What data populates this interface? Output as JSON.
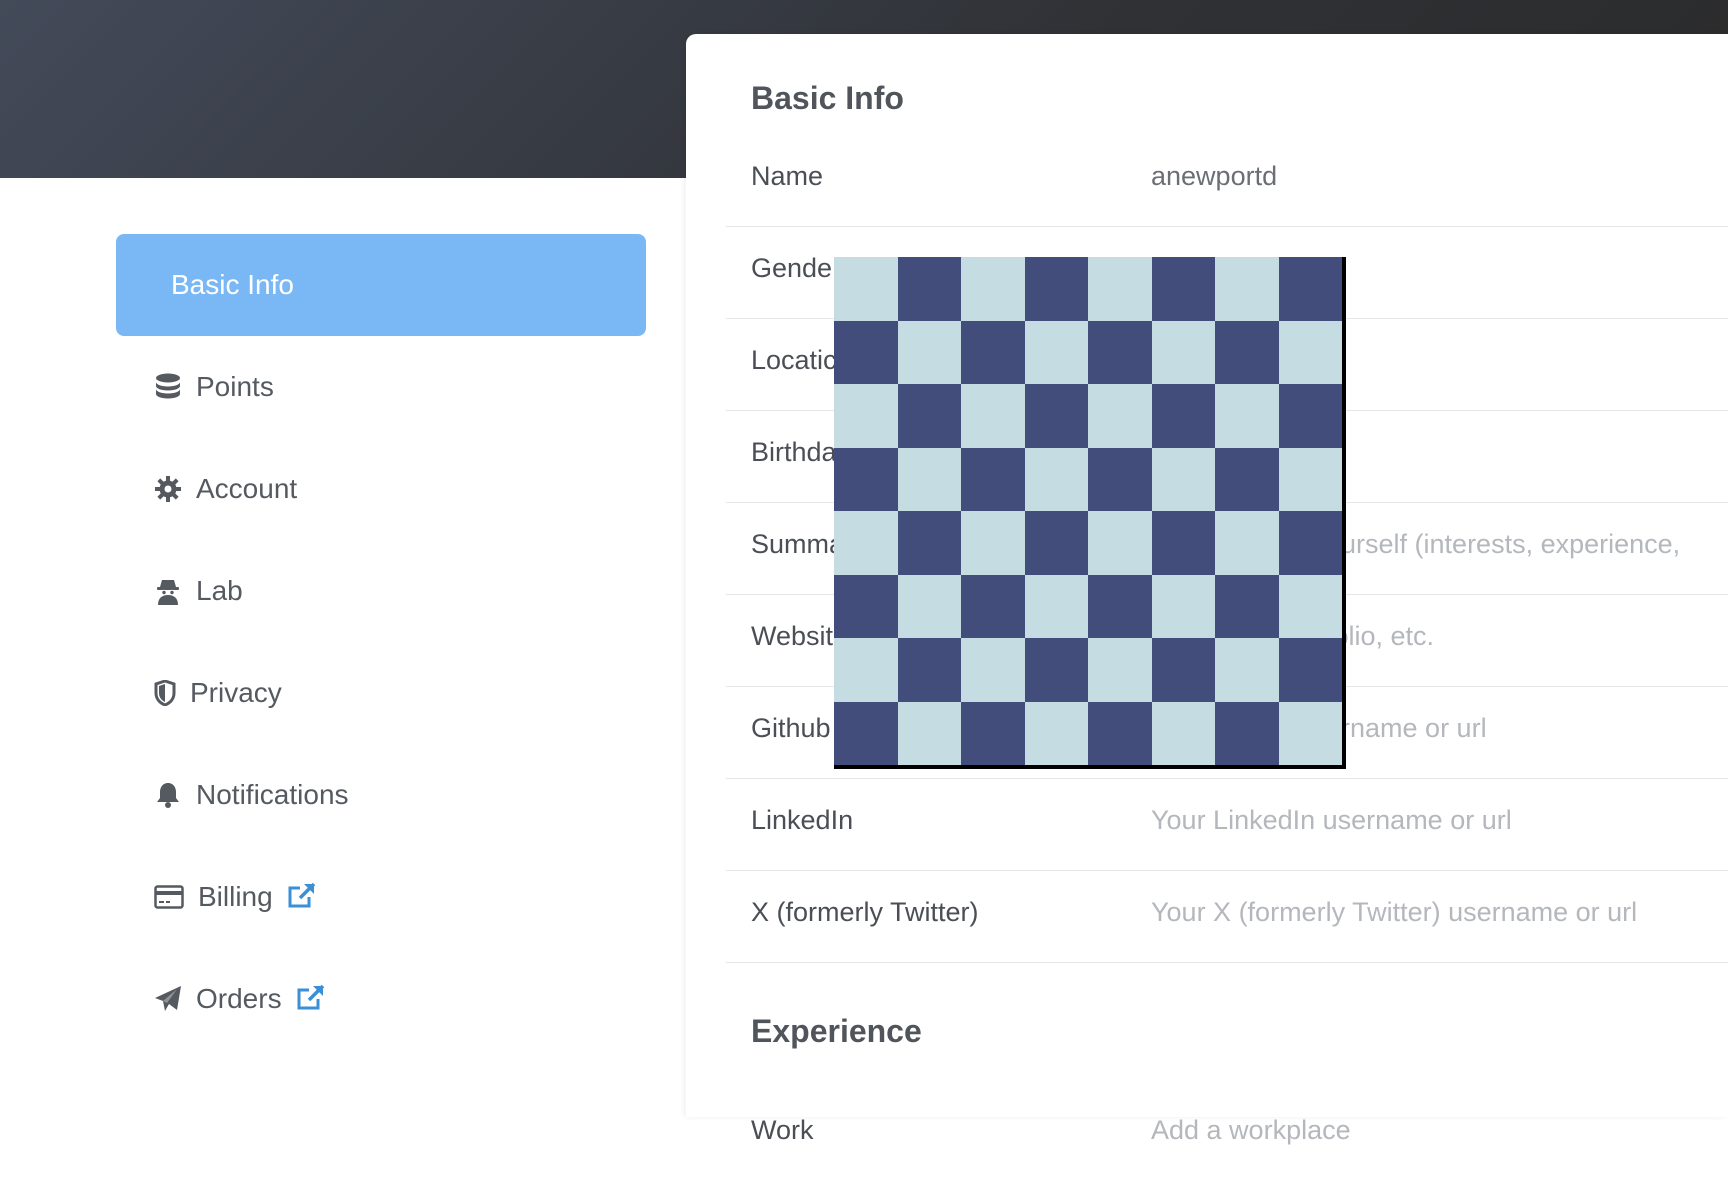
{
  "sidebar": {
    "items": [
      {
        "label": "Basic Info",
        "icon": "none",
        "active": true
      },
      {
        "label": "Points",
        "icon": "database-icon"
      },
      {
        "label": "Account",
        "icon": "gear-icon"
      },
      {
        "label": "Lab",
        "icon": "spy-icon"
      },
      {
        "label": "Privacy",
        "icon": "shield-icon"
      },
      {
        "label": "Notifications",
        "icon": "bell-icon"
      },
      {
        "label": "Billing",
        "icon": "credit-card-icon",
        "external": true
      },
      {
        "label": "Orders",
        "icon": "paper-plane-icon",
        "external": true
      }
    ],
    "active_color": "#7ab8f5",
    "external_link_color": "#3a8fd6"
  },
  "main": {
    "basic_info_title": "Basic Info",
    "fields": [
      {
        "label": "Name",
        "value": "anewportd",
        "placeholder": false
      },
      {
        "label": "Gende",
        "value": "",
        "placeholder": false
      },
      {
        "label": "Locatic",
        "value": "",
        "placeholder": false
      },
      {
        "label": "Birthda",
        "value": "",
        "placeholder": false
      },
      {
        "label": "Summa",
        "value": "ourself (interests, experience,",
        "placeholder": true
      },
      {
        "label": "Websit",
        "value": "folio, etc.",
        "placeholder": true
      },
      {
        "label": "Github",
        "value": "ername or url",
        "placeholder": true
      },
      {
        "label": "LinkedIn",
        "value": "Your LinkedIn username or url",
        "placeholder": true
      },
      {
        "label": "X (formerly Twitter)",
        "value": "Your X (formerly Twitter) username or url",
        "placeholder": true
      }
    ],
    "experience_title": "Experience",
    "work_label": "Work",
    "work_placeholder": "Add a workplace"
  },
  "overlay": {
    "type": "checkerboard",
    "light_color": "#c5dce3",
    "dark_color": "#434d7c"
  }
}
